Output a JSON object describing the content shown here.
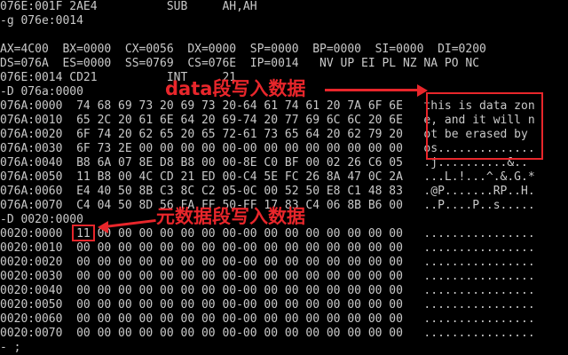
{
  "terminal": {
    "lines": [
      "076E:001F 2AE4          SUB     AH,AH",
      "-g 076e:0014",
      "",
      "AX=4C00  BX=0000  CX=0056  DX=0000  SP=0000  BP=0000  SI=0000  DI=0200",
      "DS=076A  ES=0000  SS=0769  CS=076E  IP=0014   NV UP EI PL NZ NA PO NC",
      "076E:0014 CD21          INT     21",
      "-D 076a:0000",
      "076A:0000  74 68 69 73 20 69 73 20-64 61 74 61 20 7A 6F 6E   this is data zon",
      "076A:0010  65 2C 20 61 6E 64 20 69-74 20 77 69 6C 6C 20 6E   e, and it will n",
      "076A:0020  6F 74 20 62 65 20 65 72-61 73 65 64 20 62 79 20   ot be erased by ",
      "076A:0030  6F 73 2E 00 00 00 00 00-00 00 00 00 00 00 00 00   os..............",
      "076A:0040  B8 6A 07 8E D8 B8 00 00-8E C0 BF 00 02 26 C6 05   .j..........&..",
      "076A:0050  11 B8 00 4C CD 21 ED 00-C4 5E FC 26 8A 47 0C 2A   ...L.!...^.&.G.*",
      "076A:0060  E4 40 50 8B C3 8C C2 05-0C 00 52 50 E8 C1 48 83   .@P.......RP..H.",
      "076A:0070  C4 04 50 8D 56 FA FF 50-FF 17 83 C4 06 8B B6 00   ..P....P..s.....",
      "-D 0020:0000",
      "0020:0000  11 00 00 00 00 00 00 00-00 00 00 00 00 00 00 00   ................",
      "0020:0010  00 00 00 00 00 00 00 00-00 00 00 00 00 00 00 00   ................",
      "0020:0020  00 00 00 00 00 00 00 00-00 00 00 00 00 00 00 00   ................",
      "0020:0030  00 00 00 00 00 00 00 00-00 00 00 00 00 00 00 00   ................",
      "0020:0040  00 00 00 00 00 00 00 00-00 00 00 00 00 00 00 00   ................",
      "0020:0050  00 00 00 00 00 00 00 00-00 00 00 00 00 00 00 00   ................",
      "0020:0060  00 00 00 00 00 00 00 00-00 00 00 00 00 00 00 00   ................",
      "0020:0070  00 00 00 00 00 00 00 00-00 00 00 00 00 00 00 00   ................",
      "- ;"
    ]
  },
  "annotations": {
    "data_segment_label": "data段写入数据",
    "extra_segment_label": "元数据段写入数据",
    "color": "#e8262b"
  }
}
